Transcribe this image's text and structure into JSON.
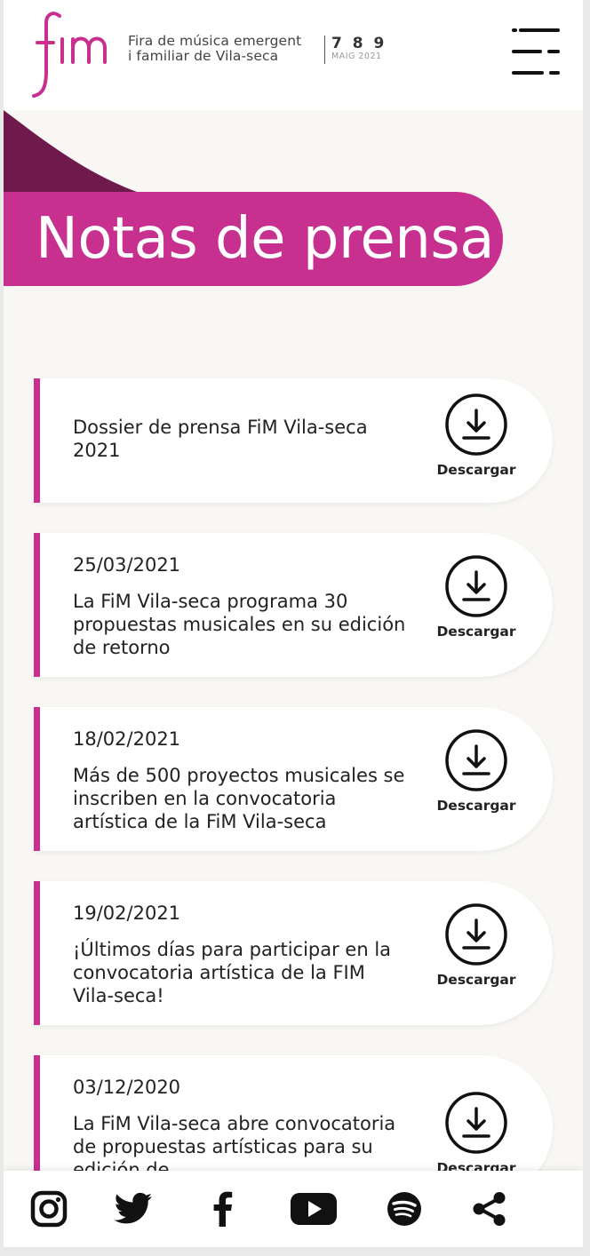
{
  "header": {
    "tagline_line1": "Fira de música emergent",
    "tagline_line2": "i familiar de Vila-seca",
    "days": "7 8 9",
    "month": "MAIG 2021",
    "logo_icon": "fim-logo-icon",
    "menu_icon": "hamburger-menu-icon"
  },
  "hero": {
    "title": "Notas de prensa"
  },
  "press_items": [
    {
      "date": "",
      "title": "Dossier de prensa FiM Vila-seca 2021",
      "action": "Descargar"
    },
    {
      "date": "25/03/2021",
      "title": "La FiM Vila-seca programa 30 propuestas musicales en su edición de retorno",
      "action": "Descargar"
    },
    {
      "date": "18/02/2021",
      "title": "Más de 500 proyectos musicales se inscriben en la convocatoria artística de la FiM Vila-seca",
      "action": "Descargar"
    },
    {
      "date": "19/02/2021",
      "title": "¡Últimos días para participar en la convocatoria artística de la FIM Vila-seca!",
      "action": "Descargar"
    },
    {
      "date": "03/12/2020",
      "title": "La FiM Vila-seca abre convocatoria de propuestas artísticas para su edición de",
      "action": "Descargar"
    }
  ],
  "footer": {
    "icons": [
      "instagram-icon",
      "twitter-icon",
      "facebook-icon",
      "youtube-icon",
      "spotify-icon",
      "share-icon"
    ]
  },
  "colors": {
    "brand_magenta": "#c7308f",
    "brand_dark": "#6f1a4c",
    "background": "#f8f7f3"
  }
}
